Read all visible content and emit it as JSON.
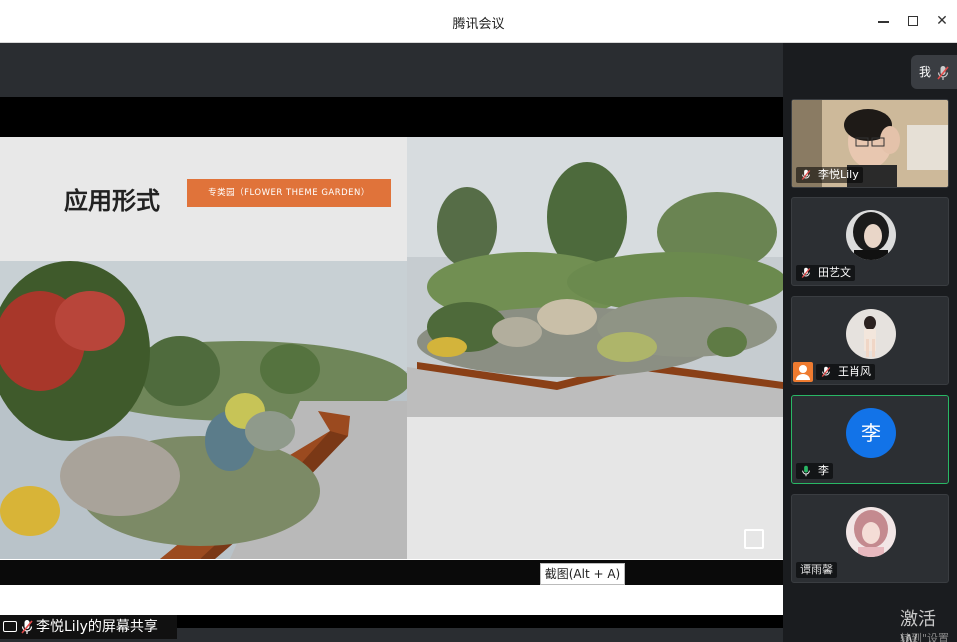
{
  "window": {
    "title": "腾讯会议"
  },
  "slide": {
    "heading": "应用形式",
    "tag": "专类园（FLOWER THEME GARDEN）"
  },
  "tooltip": "截图(Alt + A)",
  "share_banner": "李悦Lily的屏幕共享",
  "panel": {
    "me_label": "我",
    "participants": [
      {
        "name": "李悦Lily",
        "mic": "muted"
      },
      {
        "name": "田艺文",
        "mic": "muted"
      },
      {
        "name": "王肖风",
        "mic": "muted",
        "host": true
      },
      {
        "name": "李",
        "mic": "on",
        "avatar_text": "李",
        "avatar_color": "#1273e8"
      },
      {
        "name": "谭雨馨",
        "mic": "none"
      }
    ]
  },
  "watermark": {
    "line1": "激活 W",
    "line2": "转到\"设置"
  },
  "colors": {
    "accent_tag": "#e0733a",
    "active_border": "#29b765",
    "mic_muted": "#e24b4b",
    "mic_on": "#29b765"
  }
}
